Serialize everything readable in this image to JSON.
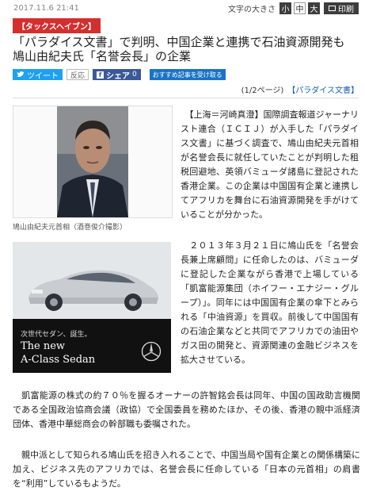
{
  "meta": {
    "date": "2017.11.6 21:41"
  },
  "font_size": {
    "label": "文字の大きさ",
    "small": "小",
    "medium": "中",
    "large": "大",
    "print": "印刷"
  },
  "kicker": "【タックスヘイブン】",
  "headline": "「パラダイス文書」で判明、中国企業と連携で石油資源開発も　鳩山由紀夫氏「名誉会長」の企業",
  "social": {
    "tweet": "ツイート",
    "reaction": "反応",
    "share": "シェア",
    "share_count": "0",
    "recommend": "おすすめ記事を受け取る"
  },
  "page_info": {
    "page": "(1/2ページ)",
    "tag": "【パラダイス文書】"
  },
  "photo": {
    "caption": "鳩山由紀夫元首相（酒巻俊介撮影）"
  },
  "ad": {
    "line1": "次世代セダン、誕生。",
    "line2": "The new",
    "line3": "A-Class Sedan"
  },
  "paragraphs": {
    "p1": "　【上海＝河崎真澄】国際調査報道ジャーナリスト連合（ＩＣＩＪ）が入手した「パラダイス文書」に基づく調査で、鳩山由紀夫元首相が名誉会長に就任していたことが判明した租税回避地、英領バミューダ諸島に登記された香港企業。この企業は中国国有企業と連携してアフリカを舞台に石油資源開発を手がけていることが分かった。",
    "p2": "　２０１３年３月２１日に鳩山氏を「名誉会長兼上席顧問」に任命したのは、バミューダに登記した企業ながら香港で上場している「凱富能源集団（ホイフー・エナジー・グループ）」。同年には中国国有企業の傘下とみられる「中油資源」を買収。前後して中国国有の石油企業などと共同でアフリカでの油田やガス田の開発と、資源関連の金融ビジネスを拡大させている。",
    "p3": "　凱富能源の株式の約７０％を握るオーナーの許智銘会長は同年、中国の国政助言機関である全国政治協商会議（政協）で全国委員を務めたほか、その後、香港の親中派経済団体、香港中華総商会の幹部職も委嘱された。",
    "p4": "　親中派として知られる鳩山氏を招き入れることで、中国当局や国有企業との関係構築に加え、ビジネス先のアフリカでは、名誉会長に任命している「日本の元首相」の肩書を“利用”しているもようだ。"
  },
  "colors": {
    "kicker_bg": "#d32f2f",
    "twitter": "#1da1f2",
    "facebook": "#3b5998",
    "tag_link": "#1a5fb4"
  }
}
